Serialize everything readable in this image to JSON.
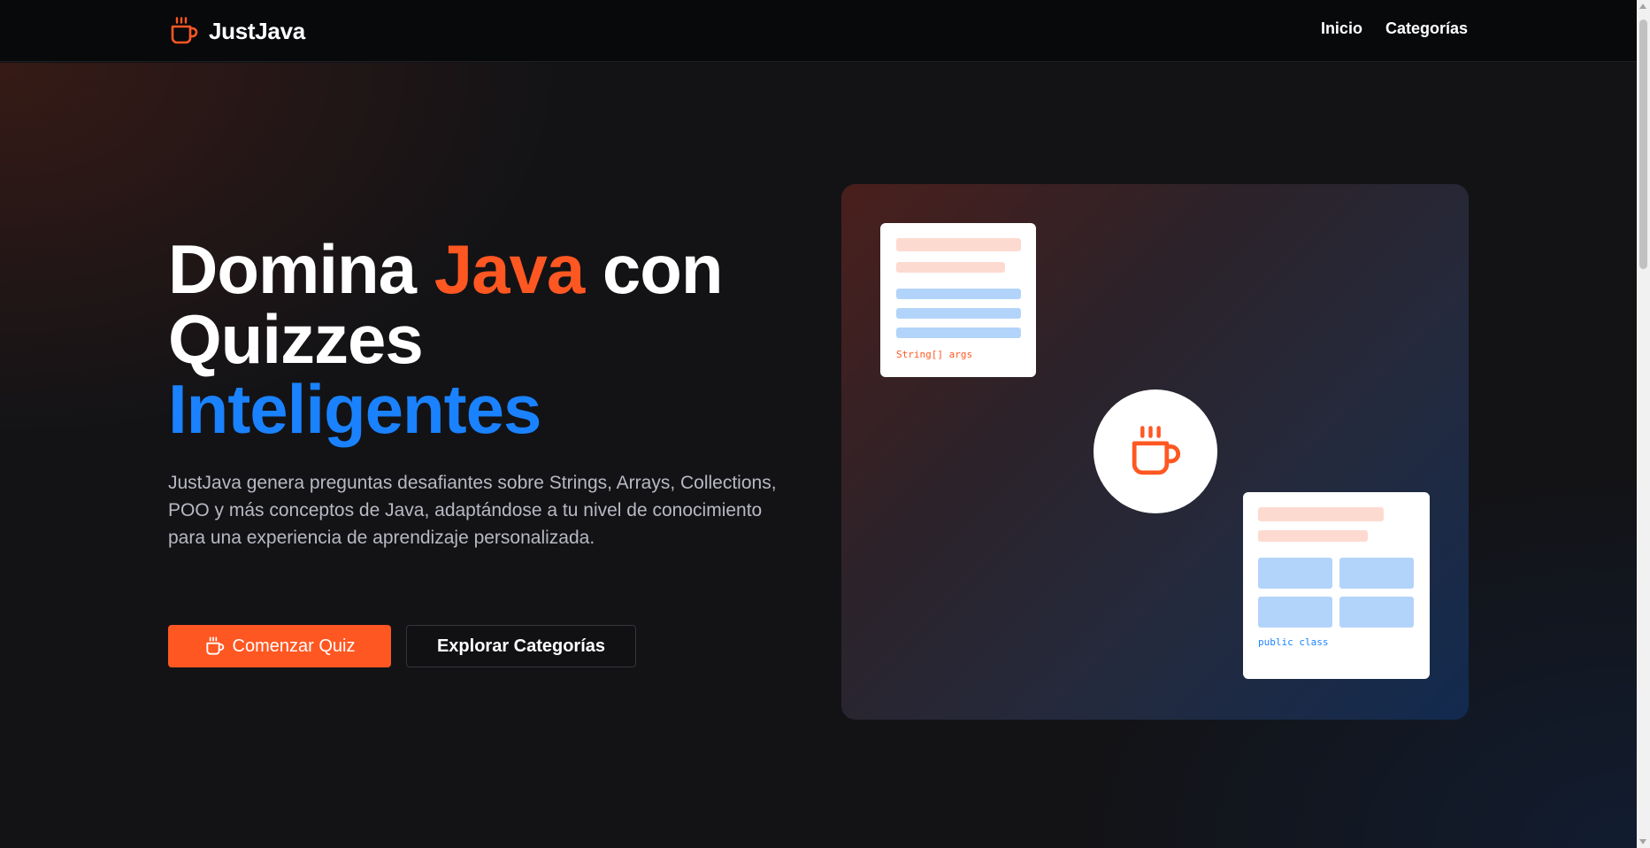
{
  "navbar": {
    "brand": "JustJava",
    "brand_icon": "coffee-cup-icon",
    "links": [
      "Inicio",
      "Categorías"
    ]
  },
  "hero": {
    "headline": {
      "part1": "Domina ",
      "part2": "Java",
      "part3": " con Quizzes ",
      "part4": "Inteligentes"
    },
    "description": "JustJava genera preguntas desafiantes sobre Strings, Arrays, Collections, POO y más conceptos de Java, adaptándose a tu nivel de conocimiento para una experiencia de aprendizaje personalizada.",
    "primary_button": "Comenzar Quiz",
    "secondary_button": "Explorar Categorías"
  },
  "illustration": {
    "card_a_code": "String[] args",
    "card_b_code": "public class",
    "center_icon": "coffee-cup-icon"
  },
  "colors": {
    "accent": "#ff5722",
    "blue": "#1a82ff",
    "background": "#131316"
  }
}
